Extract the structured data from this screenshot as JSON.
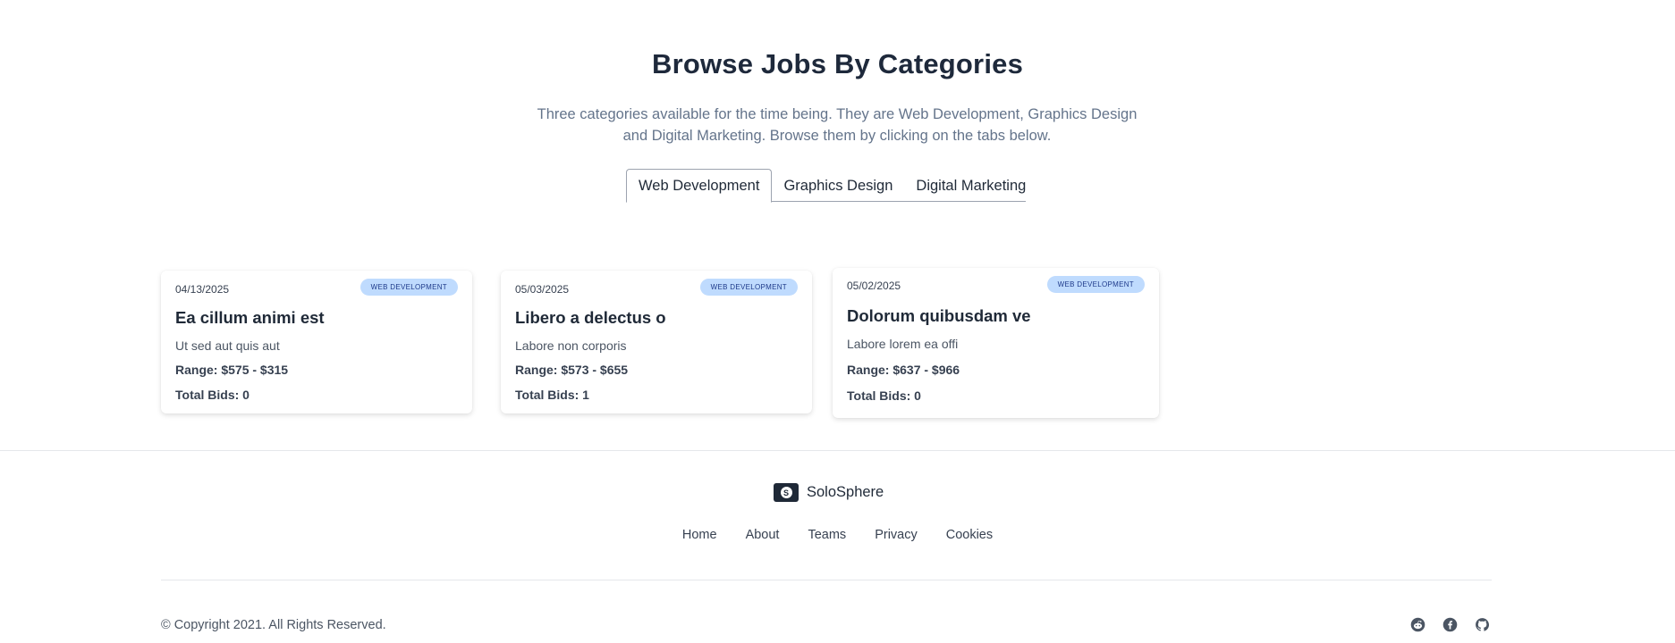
{
  "section": {
    "title": "Browse Jobs By Categories",
    "subtitle": "Three categories available for the time being. They are Web Development, Graphics Design and Digital Marketing. Browse them by clicking on the tabs below."
  },
  "tabs": [
    {
      "label": "Web Development",
      "active": true
    },
    {
      "label": "Graphics Design",
      "active": false
    },
    {
      "label": "Digital Marketing",
      "active": false
    }
  ],
  "jobs": [
    {
      "date": "04/13/2025",
      "category": "WEB DEVELOPMENT",
      "title": "Ea cillum animi est",
      "description": "Ut sed aut quis aut",
      "range": "Range: $575 - $315",
      "bids": "Total Bids: 0"
    },
    {
      "date": "05/03/2025",
      "category": "WEB DEVELOPMENT",
      "title": "Libero a delectus o",
      "description": "Labore non corporis",
      "range": "Range: $573 - $655",
      "bids": "Total Bids: 1"
    },
    {
      "date": "05/02/2025",
      "category": "WEB DEVELOPMENT",
      "title": "Dolorum quibusdam ve",
      "description": "Labore lorem ea offi",
      "range": "Range: $637 - $966",
      "bids": "Total Bids: 0"
    }
  ],
  "footer": {
    "brand": "SoloSphere",
    "brand_icon": "solosphere-logo",
    "nav": [
      "Home",
      "About",
      "Teams",
      "Privacy",
      "Cookies"
    ],
    "copyright": "© Copyright 2021. All Rights Reserved.",
    "socials": [
      "reddit-icon",
      "facebook-icon",
      "github-icon"
    ]
  },
  "colors": {
    "badge_bg": "#bfdbfe",
    "badge_text": "#1e3a8a",
    "heading": "#1e293b",
    "muted": "#64748b"
  }
}
